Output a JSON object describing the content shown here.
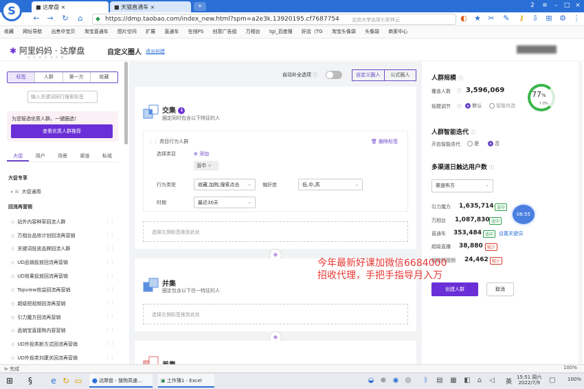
{
  "browser": {
    "tabs": [
      {
        "label": "达摩盘"
      },
      {
        "label": "天猫直通车"
      }
    ],
    "new_tab": "+",
    "url": "https://dmp.taobao.com/index_new.html?spm=a2e3k.13920195.cf7687754",
    "url_hint": "北京大学出现七彩祥云",
    "bookmarks": [
      "收藏",
      "网址导航",
      "出售中宝贝",
      "淘宝直通车",
      "图片空间",
      "扩展",
      "直通车",
      "在线PS",
      "创意广告组",
      "万相台",
      "tgi_百度搜",
      "好店（TG",
      "淘宝头像袋",
      "头像袋",
      "商家中心"
    ],
    "window_badge": "2",
    "nav_icons": [
      "back-icon",
      "forward-icon",
      "reload-icon",
      "home-icon"
    ]
  },
  "app": {
    "brand": "阿里妈妈 · 达摩盘",
    "brand_sub": "D A M O  P A N",
    "page_title": "自定义圈人",
    "exit_link": "退出创建"
  },
  "sidebar": {
    "segments": [
      {
        "label": "标签",
        "active": true
      },
      {
        "label": "人群",
        "active": false
      },
      {
        "label": "第一方",
        "active": false
      },
      {
        "label": "收藏",
        "active": false
      }
    ],
    "search_placeholder": "输入关键词同行搜索标签",
    "promo_text": "为您智选优质人群，一键圈选！",
    "promo_button": "查看优质人群推荐",
    "tabs": [
      {
        "label": "大促",
        "active": true
      },
      {
        "label": "用户",
        "active": false
      },
      {
        "label": "场景",
        "active": false
      },
      {
        "label": "渠道",
        "active": false
      },
      {
        "label": "私域",
        "active": false
      }
    ],
    "section_1": "大促专享",
    "section_1_item": "大促通用",
    "section_2": "回流再营销",
    "items": [
      "站外内容种草回流人群",
      "万相台品效计划回流再营销",
      "关键词投放品牌回流人群",
      "UD品销投放回流再营销",
      "UD效果投放回流再营销",
      "Topview效益回流再营销",
      "超级短视频回流再营销",
      "引力魔方回流再营销",
      "品销宝直接购内容营销",
      "UD外投类新方式回流再营销",
      "UD外投类刘康关回流再营销"
    ]
  },
  "center": {
    "auto_label": "自动补全选项",
    "mode_tabs": [
      {
        "label": "自定义圈人",
        "active": true
      },
      {
        "label": "公式圈人",
        "active": false
      }
    ],
    "intersect": {
      "title": "交集",
      "badge": "1",
      "desc": "圈定同时包含以下特征的人",
      "condition_title": "类目行为人群",
      "delete_label": "删除标签",
      "select_category_label": "选择类目",
      "add_label": "添加",
      "chip": "浴巾",
      "behavior_label": "行为类型",
      "behavior_value": "收藏,加购,搜索点击",
      "preference_label": "偏好度",
      "preference_value": "低,中,高",
      "period_label": "时期",
      "period_value": "最近30天",
      "drop_hint": "选择左侧标签拖到此处"
    },
    "union": {
      "title": "并集",
      "desc": "圈定包含以下任一特征的人",
      "drop_hint": "选择左侧标签拖到此处"
    },
    "diff_title": "差集"
  },
  "right": {
    "scale_title": "人群规模",
    "coverage_label": "覆盖人数",
    "coverage_value": "3,596,069",
    "scale_adjust_label": "规模调节",
    "adjust_options": [
      {
        "label": "默认",
        "on": true
      },
      {
        "label": "智能优选",
        "on": false
      }
    ],
    "gauge_value": "77",
    "gauge_unit": "%",
    "gauge_sub": "↑ 0%",
    "smart_title": "人群智能迭代",
    "smart_label": "开启智能迭代",
    "smart_options": [
      {
        "label": "是",
        "on": false
      },
      {
        "label": "否",
        "on": true
      }
    ],
    "channel_title": "多渠道日触达用户数",
    "channel_select": "渠道布方",
    "channels": [
      {
        "name": "引力魔方",
        "value": "1,635,714",
        "badge": "适中",
        "badge_type": "green"
      },
      {
        "name": "万相台",
        "value": "1,087,830",
        "badge": "适中",
        "badge_type": "green"
      },
      {
        "name": "直通车",
        "value": "353,484",
        "badge": "适中",
        "badge_type": "green",
        "extra": "设置关键词"
      },
      {
        "name": "超级直播",
        "value": "38,880",
        "badge": "较少",
        "badge_type": "red"
      },
      {
        "name": "超级短视频",
        "value": "24,462",
        "badge": "较少",
        "badge_type": "red"
      }
    ],
    "timer": "06:55",
    "create_button": "创建人群",
    "cancel_button": "取消"
  },
  "watermark": {
    "line1": "今年最新好课加微信6684000",
    "line2": "招收代理，手把手指导月入万"
  },
  "status": {
    "text": "完成",
    "zoom": "100%"
  },
  "taskbar": {
    "apps": [
      "达摩盘 - 搜狗高速...",
      "工作簿1 - Excel"
    ],
    "lang": "英",
    "time": "15:51 周六",
    "date": "2022/7/9",
    "zoom": "100%"
  },
  "colors": {
    "primary": "#6a2fd6",
    "browser_blue": "#2a6fd6",
    "gauge_green": "#3ab54a",
    "watermark": "#e53935"
  }
}
